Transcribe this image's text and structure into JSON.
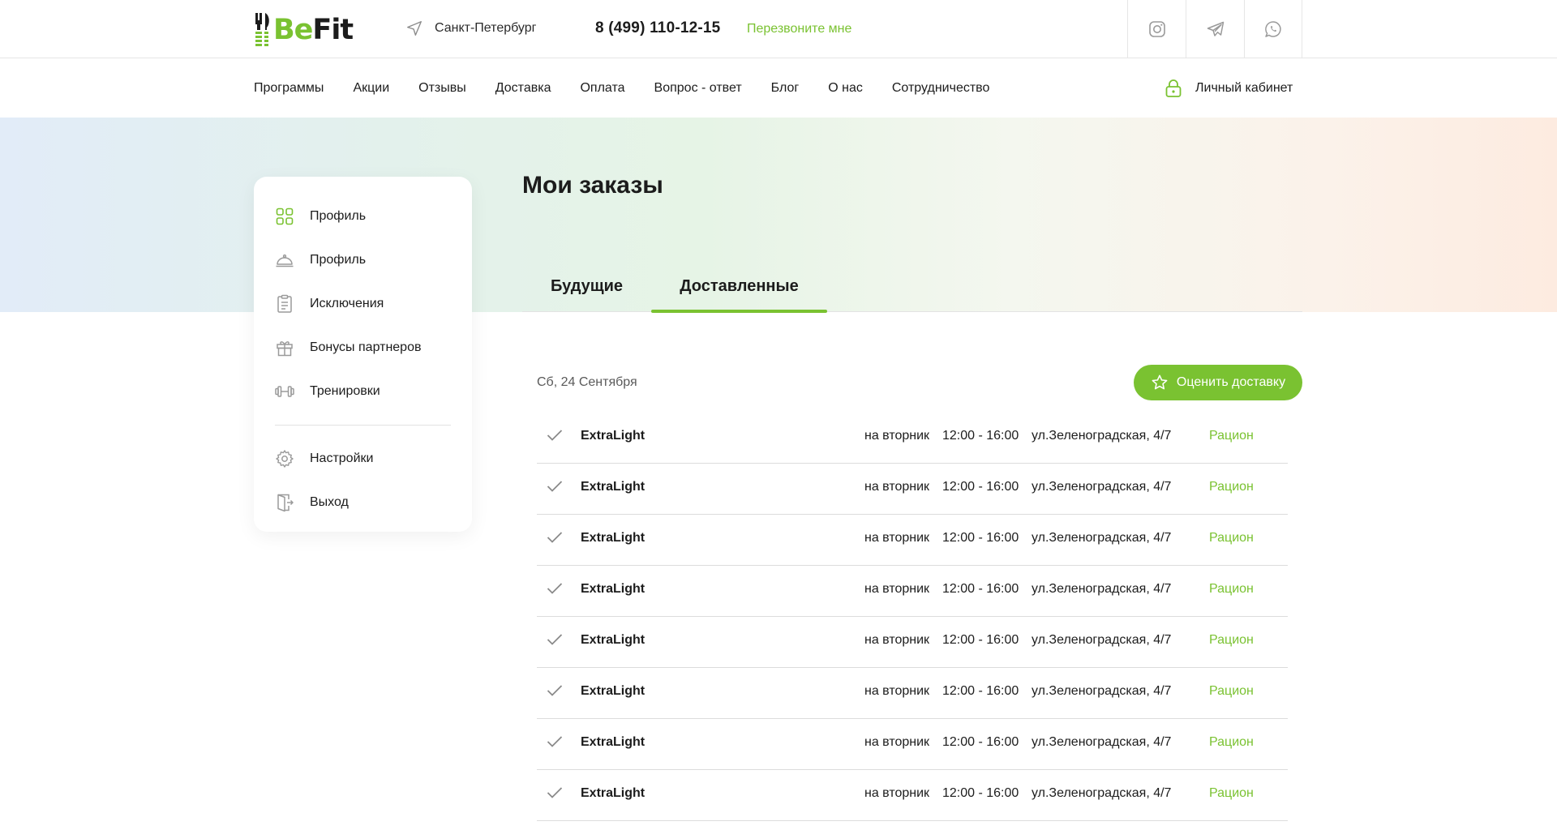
{
  "header": {
    "logo_be": "Be",
    "logo_fit": "Fit",
    "city": "Санкт-Петербург",
    "phone": "8 (499) 110-12-15",
    "callback": "Перезвоните мне",
    "socials": [
      "instagram-icon",
      "telegram-icon",
      "whatsapp-icon"
    ]
  },
  "nav": {
    "items": [
      "Программы",
      "Акции",
      "Отзывы",
      "Доставка",
      "Оплата",
      "Вопрос - ответ",
      "Блог",
      "О нас",
      "Сотрудничество"
    ],
    "cabinet": "Личный кабинет"
  },
  "sidebar": {
    "items": [
      {
        "label": "Профиль",
        "icon": "grid-icon"
      },
      {
        "label": "Профиль",
        "icon": "cloche-icon"
      },
      {
        "label": "Исключения",
        "icon": "clipboard-icon"
      },
      {
        "label": "Бонусы партнеров",
        "icon": "gift-icon"
      },
      {
        "label": "Тренировки",
        "icon": "dumbbell-icon"
      }
    ],
    "bottom_items": [
      {
        "label": "Настройки",
        "icon": "gear-icon"
      },
      {
        "label": "Выход",
        "icon": "logout-door-icon"
      }
    ]
  },
  "main": {
    "title": "Мои заказы",
    "tabs": [
      "Будущие",
      "Доставленные"
    ],
    "active_tab": "Доставленные",
    "date": "Сб, 24 Сентября",
    "rate_button": "Оценить доставку",
    "orders": [
      {
        "name": "ExtraLight",
        "day": "на вторник",
        "time": "12:00 - 16:00",
        "address": "ул.Зеленоградская, 4/7",
        "link": "Рацион"
      },
      {
        "name": "ExtraLight",
        "day": "на вторник",
        "time": "12:00 - 16:00",
        "address": "ул.Зеленоградская, 4/7",
        "link": "Рацион"
      },
      {
        "name": "ExtraLight",
        "day": "на вторник",
        "time": "12:00 - 16:00",
        "address": "ул.Зеленоградская, 4/7",
        "link": "Рацион"
      },
      {
        "name": "ExtraLight",
        "day": "на вторник",
        "time": "12:00 - 16:00",
        "address": "ул.Зеленоградская, 4/7",
        "link": "Рацион"
      },
      {
        "name": "ExtraLight",
        "day": "на вторник",
        "time": "12:00 - 16:00",
        "address": "ул.Зеленоградская, 4/7",
        "link": "Рацион"
      },
      {
        "name": "ExtraLight",
        "day": "на вторник",
        "time": "12:00 - 16:00",
        "address": "ул.Зеленоградская, 4/7",
        "link": "Рацион"
      },
      {
        "name": "ExtraLight",
        "day": "на вторник",
        "time": "12:00 - 16:00",
        "address": "ул.Зеленоградская, 4/7",
        "link": "Рацион"
      },
      {
        "name": "ExtraLight",
        "day": "на вторник",
        "time": "12:00 - 16:00",
        "address": "ул.Зеленоградская, 4/7",
        "link": "Рацион"
      }
    ]
  },
  "colors": {
    "accent": "#7ac231",
    "text": "#1c1c1c",
    "muted": "#5a5a5a",
    "icon_gray": "#9a9a9a"
  }
}
